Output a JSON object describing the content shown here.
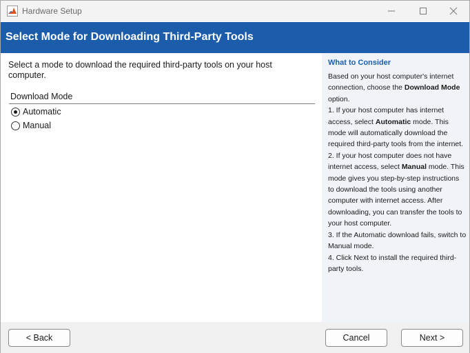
{
  "window": {
    "title": "Hardware Setup",
    "controls": [
      "minimize-icon",
      "maximize-icon",
      "close-icon"
    ]
  },
  "banner": {
    "heading": "Select Mode for Downloading Third-Party Tools",
    "color": "#1b5dab"
  },
  "main": {
    "description": "Select a mode to download the required third-party tools on your host computer.",
    "group_label": "Download Mode",
    "options": [
      {
        "label": "Automatic",
        "selected": true
      },
      {
        "label": "Manual",
        "selected": false
      }
    ]
  },
  "side": {
    "title": "What to Consider",
    "intro_pre": "Based on your host computer's internet connection, choose the ",
    "intro_bold": "Download Mode",
    "intro_post": " option.",
    "item1_pre": " 1. If your host computer has internet access, select ",
    "item1_bold": "Automatic",
    "item1_post": " mode. This mode will automatically download the required third-party tools from the internet.",
    "item2_pre": "2. If your host computer does not have internet access, select ",
    "item2_bold": "Manual",
    "item2_post": " mode. This mode gives you step-by-step instructions to download the tools using another computer with internet access. After downloading, you can transfer the tools to your host computer.",
    "item3": "3. If the Automatic download fails, switch to Manual mode.",
    "item4": "4. Click Next to install the required third-party tools."
  },
  "footer": {
    "back_label": "< Back",
    "cancel_label": "Cancel",
    "next_label": "Next >"
  }
}
